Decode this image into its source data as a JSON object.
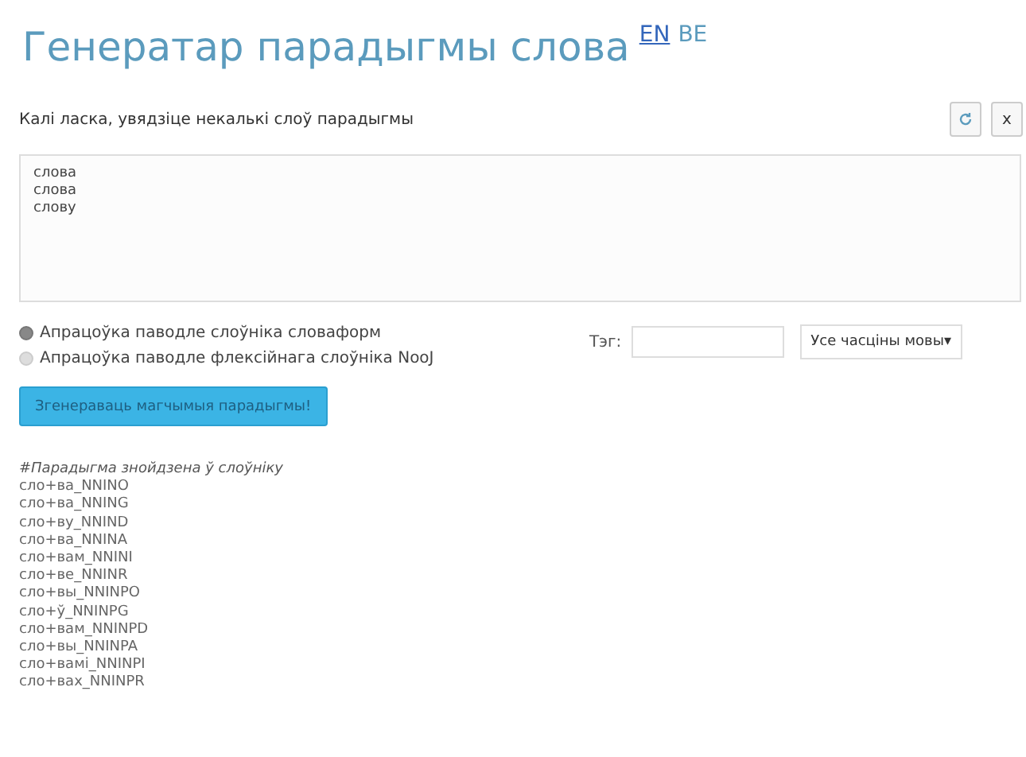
{
  "header": {
    "title": "Генератар парадыгмы слова",
    "languages": [
      {
        "label": "EN",
        "selected": false
      },
      {
        "label": "BE",
        "selected": true
      }
    ]
  },
  "prompt": "Калі ласка, увядзіце некалькі слоў парадыгмы",
  "clear_button": "x",
  "words_field": {
    "value": "слова\nслова\nслову"
  },
  "modes": [
    {
      "label": "Апрацоўка паводле слоўніка словаформ",
      "selected": true
    },
    {
      "label": "Апрацоўка паводле флексійнага слоўніка NooJ",
      "selected": false
    }
  ],
  "tag_field": {
    "label": "Тэг:"
  },
  "pos_select": {
    "value": "Усе часціны мовы",
    "caret": "▾"
  },
  "generate_button": "Згенераваць магчымыя парадыгмы!",
  "results": {
    "heading": "#Парадыгма знойдзена ў слоўніку",
    "lines": [
      "сло+ва_NNINO",
      "сло+ва_NNING",
      "сло+ву_NNIND",
      "сло+ва_NNINA",
      "сло+вам_NNINI",
      "сло+ве_NNINR",
      "сло+вы_NNINPO",
      "сло+ў_NNINPG",
      "сло+вам_NNINPD",
      "сло+вы_NNINPA",
      "сло+вамі_NNINPI",
      "сло+вах_NNINPR"
    ]
  }
}
